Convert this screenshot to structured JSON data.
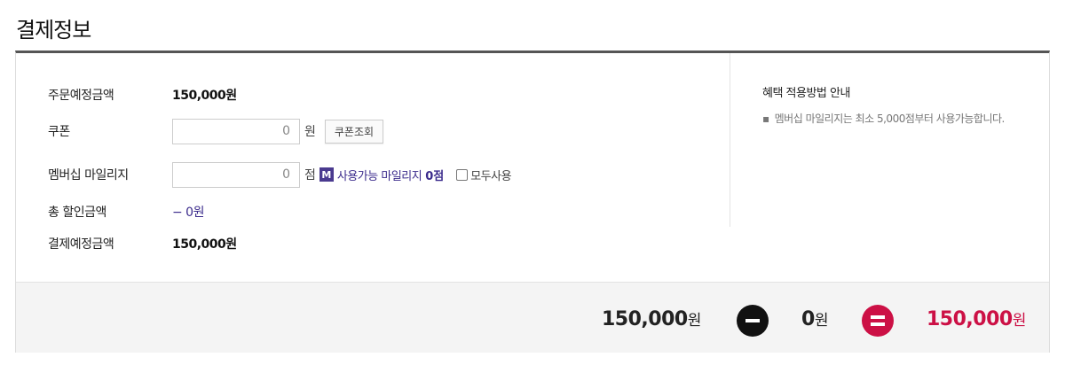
{
  "page": {
    "title": "결제정보"
  },
  "order": {
    "expected_amount_label": "주문예정금액",
    "expected_amount": "150,000원"
  },
  "coupon": {
    "label": "쿠폰",
    "value": "0",
    "unit": "원",
    "lookup_button": "쿠폰조회"
  },
  "mileage": {
    "label": "멤버십 마일리지",
    "value": "0",
    "unit": "점",
    "badge": "M",
    "available_label": "사용가능 마일리지",
    "available_amount": "0점",
    "use_all_label": "모두사용",
    "use_all_checked": false
  },
  "discount": {
    "label": "총 할인금액",
    "value": "− 0원"
  },
  "payment": {
    "label": "결제예정금액",
    "value": "150,000원"
  },
  "guide": {
    "title": "혜택 적용방법 안내",
    "note": "멤버십 마일리지는 최소 5,000점부터 사용가능합니다."
  },
  "summary": {
    "order_amount": "150,000",
    "order_unit": "원",
    "discount_amount": "0",
    "discount_unit": "원",
    "total_amount": "150,000",
    "total_unit": "원"
  },
  "colors": {
    "accent_purple": "#3b2b8c",
    "total_red": "#cc1045"
  }
}
